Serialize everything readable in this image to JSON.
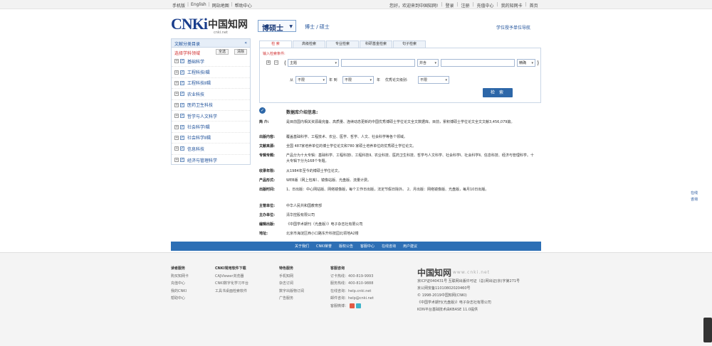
{
  "topbar": {
    "left": [
      "手机版",
      "English",
      "网站地图",
      "帮助中心"
    ],
    "right": [
      "您好，欢迎来到中国知网!",
      "登录",
      "注册",
      "充值中心",
      "我的知网卡",
      "首页"
    ]
  },
  "header": {
    "logo_en": "CNKi",
    "logo_cn": "中国知网",
    "logo_net": "cnki.net",
    "db_select": "博硕士",
    "subtitle": "博士 / 硕士",
    "nav_link": "学位授予单位导航"
  },
  "sidebar": {
    "title": "文献分类目录",
    "hint": "选择学科领域",
    "select_all": "全选",
    "clear": "清除",
    "items": [
      "基础科学",
      "工程科技Ⅰ辑",
      "工程科技Ⅱ辑",
      "农业科技",
      "医药卫生科技",
      "哲学与人文科学",
      "社会科学Ⅰ辑",
      "社会科学Ⅱ辑",
      "信息科技",
      "经济与管理科学"
    ]
  },
  "tabs": [
    "检 索",
    "高级检索",
    "专业检索",
    "科研基金检索",
    "句子检索"
  ],
  "search": {
    "label": "输入检索条件:",
    "field1": "主题",
    "op": "并含",
    "match": "精确",
    "from_label": "从",
    "year_from": "不限",
    "to_label": "年 到",
    "year_to": "不限",
    "year_suffix": "年",
    "update_label": "优秀论文级别:",
    "update_value": "不限",
    "button": "检 索"
  },
  "info": {
    "title": "数据库介绍信息:",
    "rows": [
      {
        "k": "简 介:",
        "v": "是目前国内相关资源最完备、高质量、连续动态更新的中国优秀博硕士学位论文全文数据库。目前，累积博硕士学位论文全文文献3,456,079篇。"
      },
      {
        "k": "出版内容:",
        "v": "覆盖基础科学、工程技术、农业、医学、哲学、人文、社会科学等各个领域。"
      },
      {
        "k": "文献来源:",
        "v": "全国 487家培养单位的博士学位论文和780 家硕士培养单位的优秀硕士学位论文。"
      },
      {
        "k": "专辑专题:",
        "v": "产品分为十大专辑：基础科学、工程科技Ⅰ、工程科技Ⅱ、农业科技、医药卫生科技、哲学与人文科学、社会科学Ⅰ、社会科学Ⅱ、信息科技、经济与管理科学。十大专辑下分为168个专题。"
      },
      {
        "k": "收录年限:",
        "v": "从1984年至今的博硕士学位论文。"
      },
      {
        "k": "产品形式:",
        "v": "WEB版（网上包库）、镜像站版、光盘版、流量计费。"
      },
      {
        "k": "出版时间:",
        "v": "1、日出版：中心网站版、网络镜像版，每个工作日出版，法定节假日除外。 2、月出版：网络镜像版、光盘版，每月10日出版。"
      },
      {
        "k": "主管单位:",
        "v": "中华人民共和国教育部"
      },
      {
        "k": "主办单位:",
        "v": "清华控股有限公司"
      },
      {
        "k": "编辑出版:",
        "v": "《中国学术期刊（光盘版）》电子杂志社有限公司"
      },
      {
        "k": "地址:",
        "v": "北京市海淀区西小口路东升科技园北领地A2楼"
      }
    ]
  },
  "side_fix": [
    "在线",
    "咨询"
  ],
  "bluebar": [
    "关于我们",
    "CNKI荣誉",
    "版权公告",
    "客服中心",
    "在线咨询",
    "用户建议"
  ],
  "footer": {
    "cols": [
      {
        "h": "读者服务",
        "items": [
          "购买知网卡",
          "充值中心",
          "我的CNKI",
          "帮助中心"
        ]
      },
      {
        "h": "CNKI常用软件下载",
        "items": [
          "CAJViewer浏览器",
          "CNKI数字化学习平台",
          "工具书桌面检索软件"
        ]
      },
      {
        "h": "特色服务",
        "items": [
          "手机知网",
          "杂志订阅",
          "数字出版物订阅",
          "广告服务"
        ]
      },
      {
        "h": "客服咨询",
        "items": [
          "订卡热线：400-819-9993",
          "服务热线：400-810-9888",
          "在线咨询：help.cnki.net",
          "邮件咨询：help@cnki.net",
          "客服微博："
        ]
      }
    ],
    "logo": "中国知网",
    "logo_net": "www.cnki.net",
    "info": [
      "京ICP证040431号 互联网出版许可证（总)网出证(京)字第271号",
      "京公网安备11010802020460号",
      "© 1998-2019中国知网(CNKI)",
      "《中国学术期刊(光盘版)》电子杂志社有限公司",
      "KDN平台基础技术由KBASE 11.0提供"
    ]
  }
}
